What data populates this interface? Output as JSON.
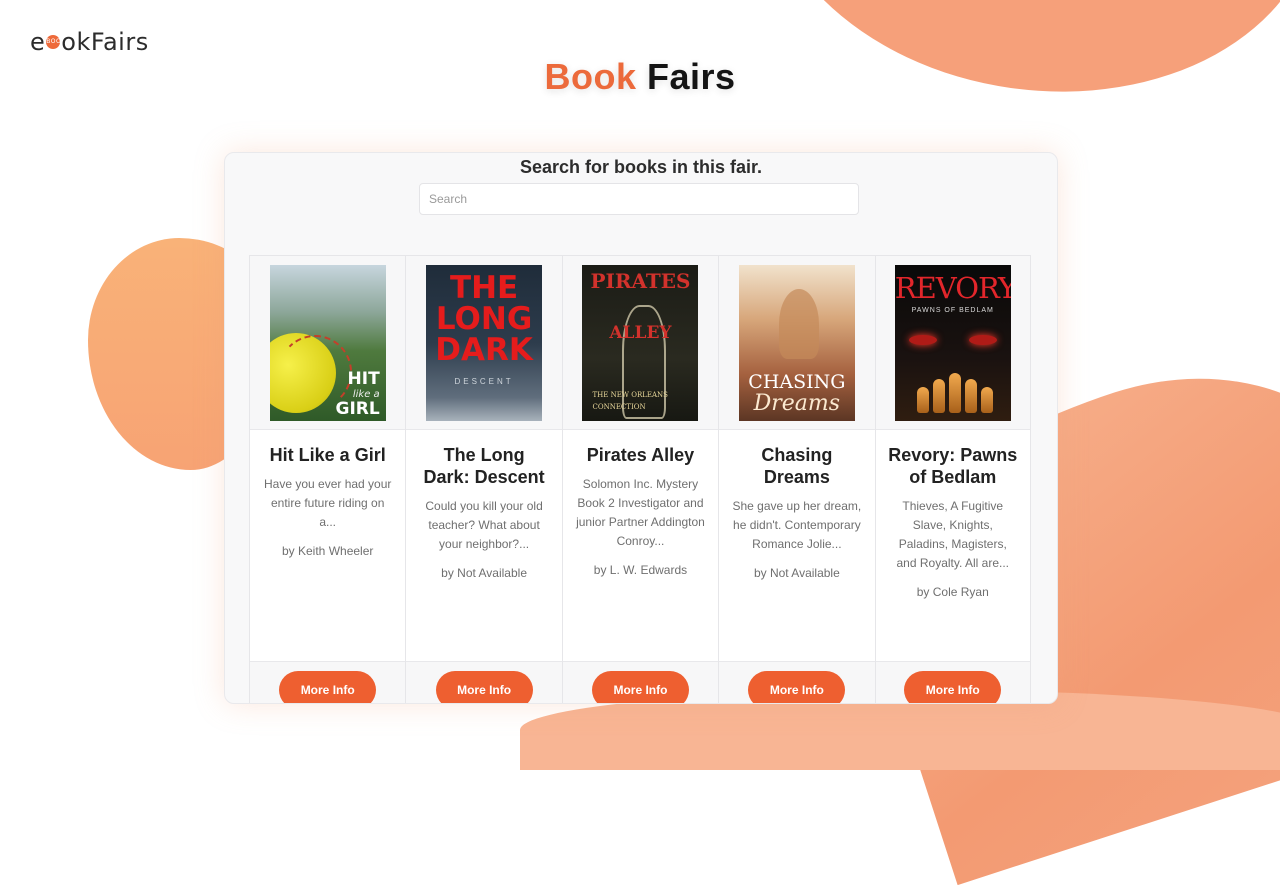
{
  "logo": {
    "text_left": "e",
    "badge": "BOOK",
    "text_right": "okFairs"
  },
  "page_title": {
    "accent": "Book",
    "rest": "Fairs"
  },
  "panel": {
    "heading": "Search for books in this fair.",
    "search_placeholder": "Search"
  },
  "books": [
    {
      "title": "Hit Like a Girl",
      "description": "Have you ever had your entire future riding on a...",
      "author": "by Keith Wheeler",
      "button": "More Info",
      "cover_text": "HIT",
      "cover_sub": "like a",
      "cover_text2": "GIRL"
    },
    {
      "title": "The Long Dark: Descent",
      "description": "Could you kill your old teacher? What about your neighbor?...",
      "author": "by Not Available",
      "button": "More Info",
      "cover_text": "THE LONG DARK",
      "cover_sub": "DESCENT"
    },
    {
      "title": "Pirates Alley",
      "description": "Solomon Inc. Mystery Book 2 Investigator and junior Partner Addington Conroy...",
      "author": "by L. W. Edwards",
      "button": "More Info",
      "cover_text": "PIRATES",
      "cover_text2": "ALLEY",
      "cover_sub": "THE NEW ORLEANS CONNECTION"
    },
    {
      "title": "Chasing Dreams",
      "description": "She gave up her dream, he didn't. Contemporary Romance Jolie...",
      "author": "by Not Available",
      "button": "More Info",
      "cover_text": "CHASING",
      "cover_text2": "Dreams"
    },
    {
      "title": "Revory: Pawns of Bedlam",
      "description": "Thieves, A Fugitive Slave, Knights, Paladins, Magisters, and Royalty. All are...",
      "author": "by Cole Ryan",
      "button": "More Info",
      "cover_text": "REVORY",
      "cover_sub": "PAWNS OF BEDLAM"
    }
  ],
  "colors": {
    "accent": "#ec6a3b",
    "button": "#ee5f30",
    "blob": "#f6a07a"
  }
}
